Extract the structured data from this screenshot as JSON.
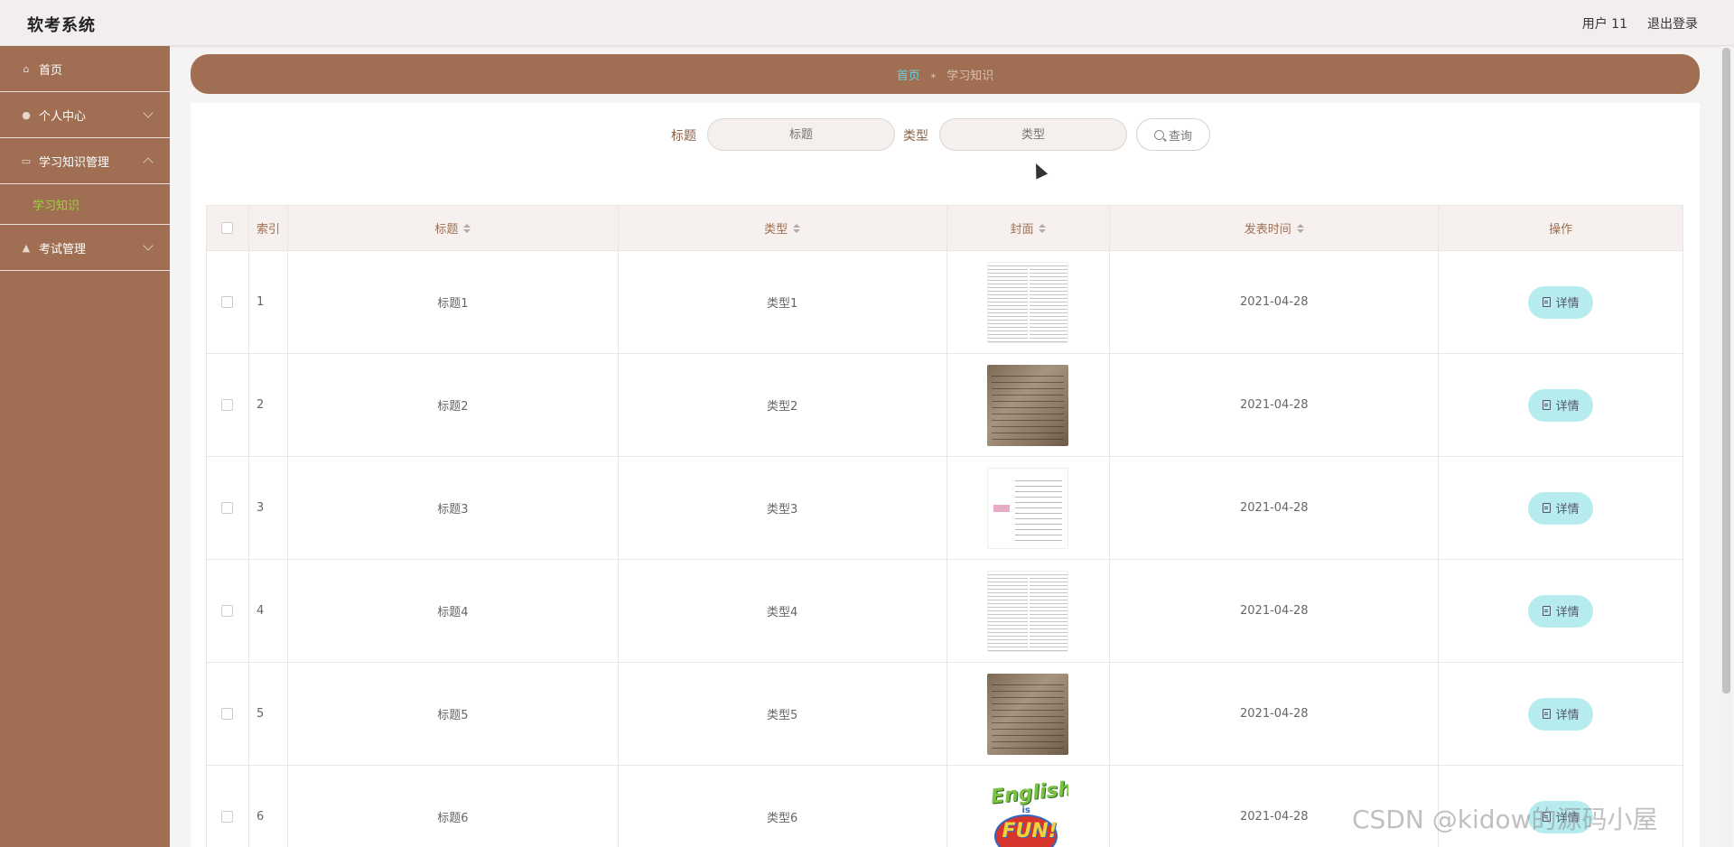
{
  "app": {
    "title": "软考系统"
  },
  "header": {
    "user": "用户 11",
    "logout": "退出登录"
  },
  "sidebar": {
    "items": [
      {
        "label": "首页",
        "icon": "home-icon"
      },
      {
        "label": "个人中心",
        "icon": "user-icon"
      },
      {
        "label": "学习知识管理",
        "icon": "book-icon",
        "subitems": [
          {
            "label": "学习知识",
            "active": true
          }
        ]
      },
      {
        "label": "考试管理",
        "icon": "exam-icon"
      }
    ]
  },
  "breadcrumb": {
    "home": "首页",
    "separator": "⁎",
    "current": "学习知识"
  },
  "search": {
    "title_label": "标题",
    "title_placeholder": "标题",
    "type_label": "类型",
    "type_placeholder": "类型",
    "button": "查询"
  },
  "table": {
    "headers": {
      "index": "索引",
      "title": "标题",
      "type": "类型",
      "cover": "封面",
      "time": "发表时间",
      "action": "操作"
    },
    "rows": [
      {
        "index": "1",
        "title": "标题1",
        "type": "类型1",
        "cover": "notes-list",
        "time": "2021-04-28",
        "action": "详情"
      },
      {
        "index": "2",
        "title": "标题2",
        "type": "类型2",
        "cover": "paper-photo",
        "time": "2021-04-28",
        "action": "详情"
      },
      {
        "index": "3",
        "title": "标题3",
        "type": "类型3",
        "cover": "mind-map",
        "time": "2021-04-28",
        "action": "详情"
      },
      {
        "index": "4",
        "title": "标题4",
        "type": "类型4",
        "cover": "notes-list",
        "time": "2021-04-28",
        "action": "详情"
      },
      {
        "index": "5",
        "title": "标题5",
        "type": "类型5",
        "cover": "paper-photo",
        "time": "2021-04-28",
        "action": "详情"
      },
      {
        "index": "6",
        "title": "标题6",
        "type": "类型6",
        "cover": "english-is-fun",
        "time": "2021-04-28",
        "action": "详情"
      }
    ]
  },
  "cover_6_text": {
    "word": "English",
    "is": "is",
    "fun": "FUN!"
  },
  "watermark": "CSDN @kidow的源码小屋",
  "colors": {
    "sidebar": "#a06e52",
    "accent_green": "#9bd43a",
    "breadcrumb_home": "#62d4e2",
    "detail_button": "#b7ecef"
  }
}
